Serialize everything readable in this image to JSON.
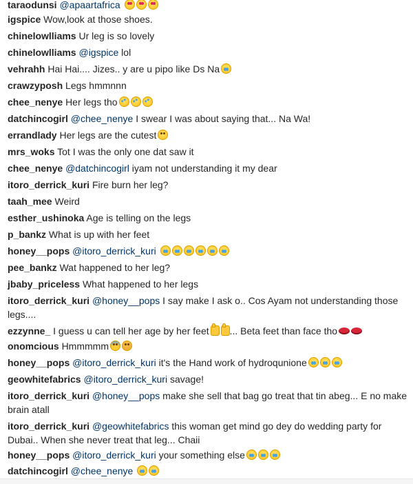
{
  "comments": [
    {
      "user": "taraodunsi",
      "mention": "@apaartafrica",
      "text": "",
      "emoji": [
        "heart-eyes",
        "heart-eyes",
        "heart-eyes"
      ]
    },
    {
      "user": "igspice",
      "mention": "",
      "text": "Wow,look at those shoes.",
      "emoji": []
    },
    {
      "user": "chinelowlliams",
      "mention": "",
      "text": "Ur leg is so lovely",
      "emoji": []
    },
    {
      "user": "chinelowlliams",
      "mention": "@igspice",
      "text": "lol",
      "emoji": []
    },
    {
      "user": "vehrahh",
      "mention": "",
      "text": "Hai Hai.... Jizes.. y are u pipo like Ds Na",
      "emoji": [
        "tears"
      ]
    },
    {
      "user": "crawzyposh",
      "mention": "",
      "text": "Legs hmmnnn",
      "emoji": []
    },
    {
      "user": "chee_nenye",
      "mention": "",
      "text": "Her legs tho",
      "emoji": [
        "rofl",
        "rofl",
        "rofl"
      ]
    },
    {
      "user": "datchincogirl",
      "mention": "@chee_nenye",
      "text": "I swear I was about saying that... Na Wa!",
      "emoji": []
    },
    {
      "user": "errandlady",
      "mention": "",
      "text": "Her legs are the cutest",
      "emoji": [
        "smile"
      ]
    },
    {
      "user": "mrs_woks",
      "mention": "",
      "text": "Tot I was the only one dat saw it",
      "emoji": []
    },
    {
      "user": "chee_nenye",
      "mention": "@datchincogirl",
      "text": "iyam not understanding it my dear",
      "emoji": []
    },
    {
      "user": "itoro_derrick_kuri",
      "mention": "",
      "text": "Fire burn her leg?",
      "emoji": []
    },
    {
      "user": "taah_mee",
      "mention": "",
      "text": "Weird",
      "emoji": []
    },
    {
      "user": "esther_ushinoka",
      "mention": "",
      "text": "Age is telling on the legs",
      "emoji": []
    },
    {
      "user": "p_bankz",
      "mention": "",
      "text": "What is up with her feet",
      "emoji": []
    },
    {
      "user": "honey__pops",
      "mention": "@itoro_derrick_kuri",
      "text": "",
      "emoji": [
        "tears",
        "tears",
        "tears",
        "tears",
        "tears",
        "tears"
      ]
    },
    {
      "user": "pee_bankz",
      "mention": "",
      "text": "Wat happened to her leg?",
      "emoji": []
    },
    {
      "user": "jbaby_priceless",
      "mention": "",
      "text": "What happened to her legs",
      "emoji": []
    },
    {
      "user": "itoro_derrick_kuri",
      "mention": "@honey__pops",
      "text": "I say make I ask o.. Cos Ayam not understanding those legs....",
      "emoji": []
    },
    {
      "user": "ezzynne_",
      "mention": "",
      "text": "I guess u can tell her age by her feet",
      "emoji": [
        "thumb",
        "thumb"
      ],
      "after": "... Beta feet than face tho",
      "emoji_after": [
        "lips",
        "lips"
      ]
    },
    {
      "user": "onomcious",
      "mention": "",
      "text": "Hmmmmm",
      "emoji": [
        "blue",
        "angry"
      ]
    },
    {
      "user": "honey__pops",
      "mention": "@itoro_derrick_kuri",
      "text": "it's the Hand work of hydroqunione",
      "emoji": [
        "tears",
        "tears",
        "tears"
      ]
    },
    {
      "user": "geowhitefabrics",
      "mention": "@itoro_derrick_kuri",
      "text": "savage!",
      "emoji": []
    },
    {
      "user": "itoro_derrick_kuri",
      "mention": "@honey__pops",
      "text": "make she sell that bag go treat that tin abeg... E no make brain atall",
      "emoji": []
    },
    {
      "user": "itoro_derrick_kuri",
      "mention": "@geowhitefabrics",
      "text": "this woman get mind go dey do wedding party for Dubai.. When she never treat that leg... Chaii",
      "emoji": []
    },
    {
      "user": "honey__pops",
      "mention": "@itoro_derrick_kuri",
      "text": "your something else",
      "emoji": [
        "tears",
        "tears",
        "tears"
      ]
    },
    {
      "user": "datchincogirl",
      "mention": "@chee_nenye",
      "text": "",
      "emoji": [
        "tears",
        "tears"
      ]
    }
  ]
}
